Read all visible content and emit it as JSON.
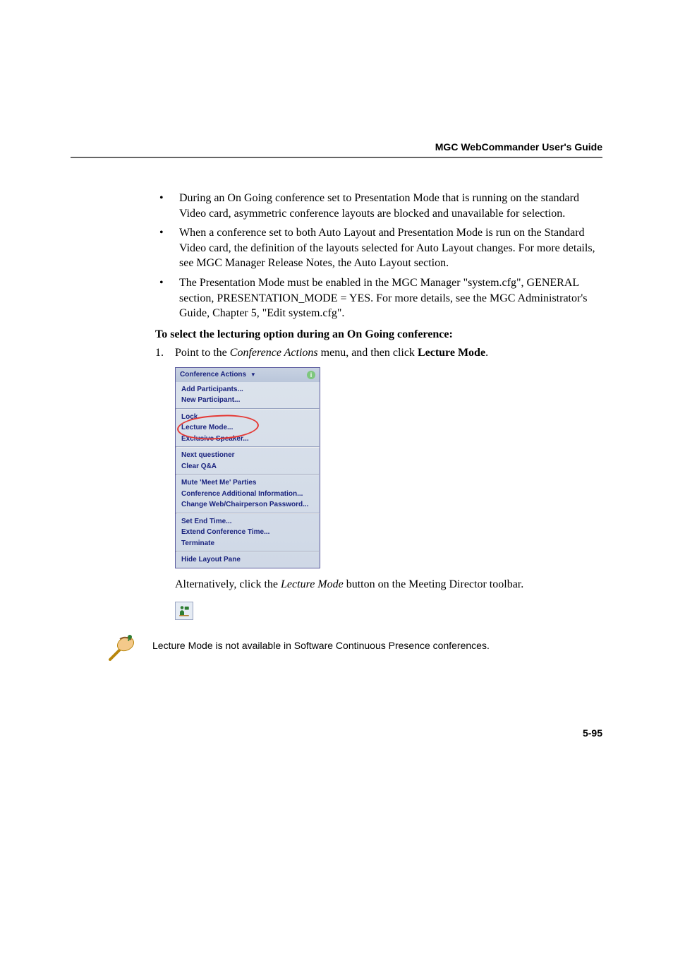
{
  "header": {
    "title": "MGC WebCommander User's Guide"
  },
  "bullets": [
    "During an On Going conference set to Presentation Mode that is running on the standard Video card, asymmetric conference layouts are blocked and unavailable for selection.",
    "When a conference set to both Auto Layout and Presentation Mode is run on the Standard Video card, the definition of the layouts selected for Auto Layout changes. For more details, see MGC Manager Release Notes, the Auto Layout section.",
    "The Presentation Mode must be enabled in the MGC Manager \"system.cfg\", GENERAL section, PRESENTATION_MODE = YES. For more details, see the MGC Administrator's Guide, Chapter 5, \"Edit system.cfg\"."
  ],
  "heading": "To select the lecturing option during an On Going conference:",
  "step1": {
    "num": "1.",
    "pre": "Point to the ",
    "italic": "Conference Actions",
    "mid": " menu, and then click ",
    "bold": "Lecture Mode",
    "post": "."
  },
  "menu": {
    "title": "Conference Actions",
    "g1": [
      "Add Participants...",
      "New Participant..."
    ],
    "g2": [
      "Lock",
      "Lecture Mode...",
      "Exclusive Speaker..."
    ],
    "g3": [
      "Next questioner",
      "Clear Q&A"
    ],
    "g4": [
      "Mute 'Meet Me' Parties",
      "Conference Additional Information...",
      "Change Web/Chairperson Password..."
    ],
    "g5": [
      "Set End Time...",
      "Extend Conference Time...",
      "Terminate"
    ],
    "g6": [
      "Hide Layout Pane"
    ]
  },
  "after": {
    "pre": "Alternatively, click the ",
    "italic": "Lecture Mode",
    "post": " button on the Meeting Director toolbar."
  },
  "note": "Lecture Mode is not available in Software Continuous Presence conferences.",
  "pagenum": "5-95"
}
